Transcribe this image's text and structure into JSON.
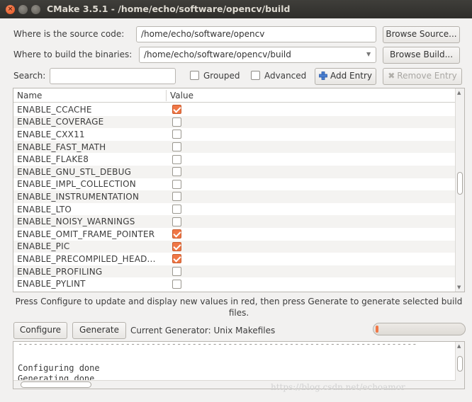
{
  "window": {
    "title": "CMake 3.5.1 - /home/echo/software/opencv/build",
    "close_glyph": "×"
  },
  "paths": {
    "source_label": "Where is the source code:",
    "source_value": "/home/echo/software/opencv",
    "browse_source": "Browse Source...",
    "build_label": "Where to build the binaries:",
    "build_value": "/home/echo/software/opencv/build",
    "browse_build": "Browse Build..."
  },
  "search": {
    "label": "Search:",
    "value": "",
    "grouped_label": "Grouped",
    "grouped_checked": false,
    "advanced_label": "Advanced",
    "advanced_checked": false,
    "add_entry": "Add Entry",
    "remove_entry": "Remove Entry"
  },
  "table": {
    "headers": [
      "Name",
      "Value"
    ],
    "rows": [
      {
        "name": "ENABLE_CCACHE",
        "checked": true
      },
      {
        "name": "ENABLE_COVERAGE",
        "checked": false
      },
      {
        "name": "ENABLE_CXX11",
        "checked": false
      },
      {
        "name": "ENABLE_FAST_MATH",
        "checked": false
      },
      {
        "name": "ENABLE_FLAKE8",
        "checked": false
      },
      {
        "name": "ENABLE_GNU_STL_DEBUG",
        "checked": false
      },
      {
        "name": "ENABLE_IMPL_COLLECTION",
        "checked": false
      },
      {
        "name": "ENABLE_INSTRUMENTATION",
        "checked": false
      },
      {
        "name": "ENABLE_LTO",
        "checked": false
      },
      {
        "name": "ENABLE_NOISY_WARNINGS",
        "checked": false
      },
      {
        "name": "ENABLE_OMIT_FRAME_POINTER",
        "checked": true
      },
      {
        "name": "ENABLE_PIC",
        "checked": true
      },
      {
        "name": "ENABLE_PRECOMPILED_HEAD...",
        "checked": true
      },
      {
        "name": "ENABLE_PROFILING",
        "checked": false
      },
      {
        "name": "ENABLE_PYLINT",
        "checked": false
      }
    ]
  },
  "status": {
    "message": "Press Configure to update and display new values in red, then press Generate to generate selected build files.",
    "configure": "Configure",
    "generate": "Generate",
    "current_generator": "Current Generator: Unix Makefiles",
    "progress": 0.02
  },
  "log": {
    "separator": "------------------------------------------------------------------------------",
    "lines": [
      "Configuring done",
      "Generating done"
    ]
  },
  "watermark": "https://blog.csdn.net/echoamor",
  "colors": {
    "accent": "#f07746",
    "titlebar": "#3a3935",
    "window_bg": "#f2f1f0"
  }
}
